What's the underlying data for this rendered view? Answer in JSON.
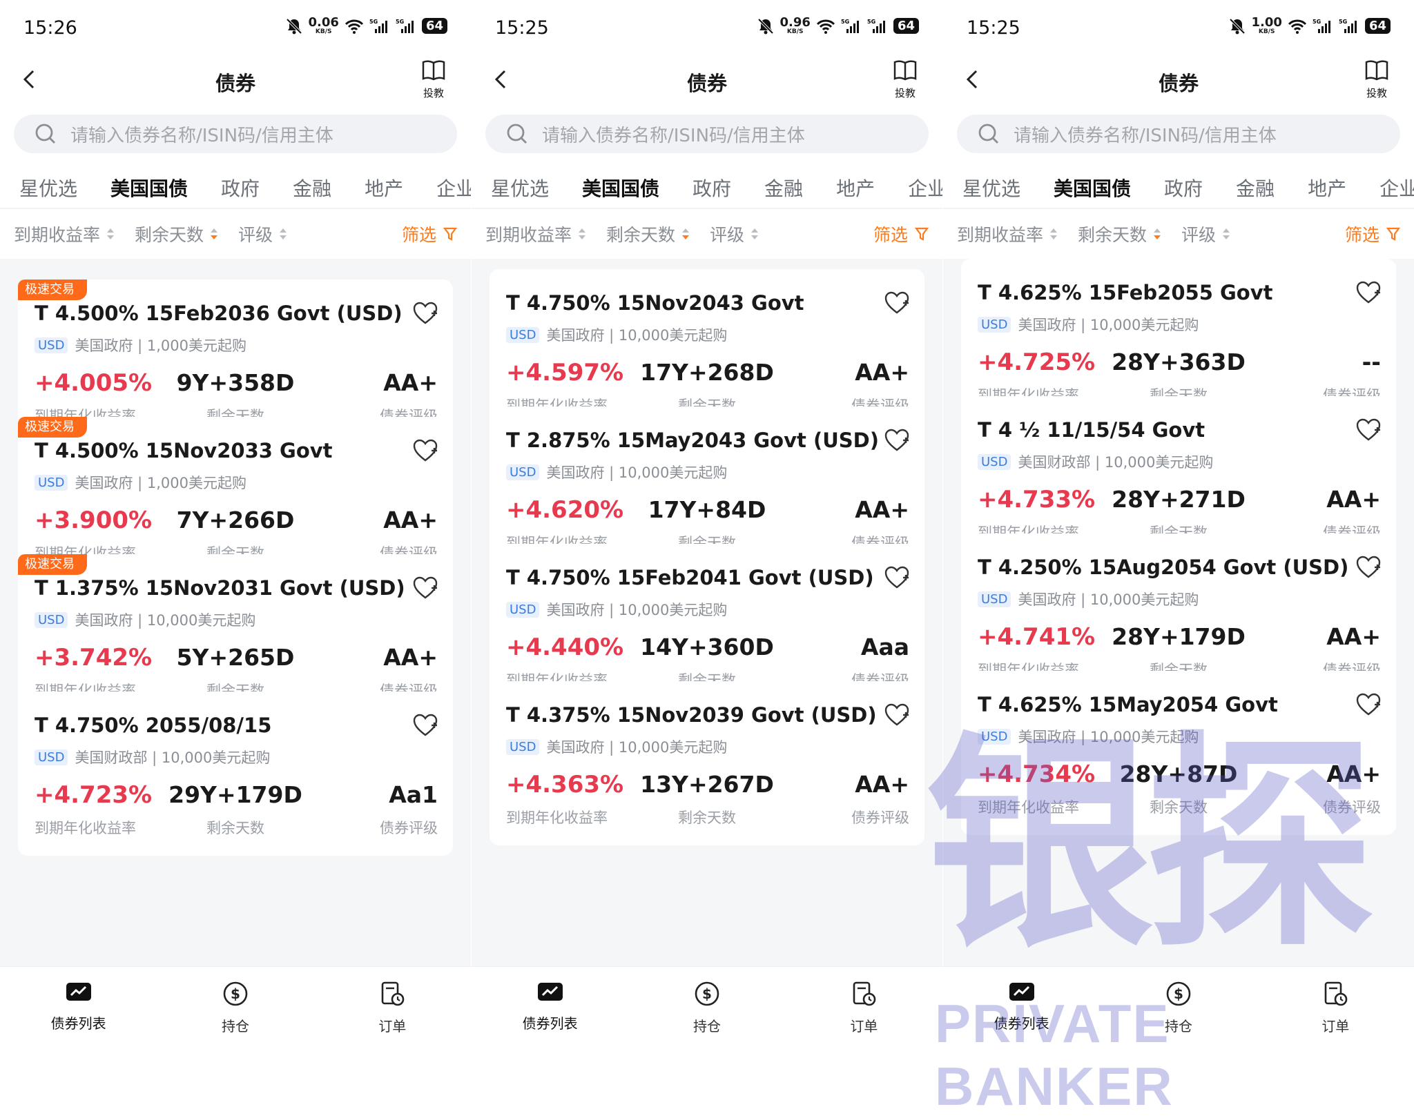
{
  "accent": "#ff7a1a",
  "yield_color": "#e83a4f",
  "screens": [
    {
      "status": {
        "time": "15:26",
        "speed": "0.06",
        "unit": "KB/S",
        "battery": "64"
      },
      "nav": {
        "title": "债券",
        "tutorial": "投教"
      },
      "search": {
        "placeholder": "请输入债券名称/ISIN码/信用主体"
      },
      "tabs": [
        "星优选",
        "美国国债",
        "政府",
        "金融",
        "地产",
        "企业"
      ],
      "sorts": [
        "到期收益率",
        "剩余天数",
        "评级"
      ],
      "filter": "筛选",
      "cards": [
        {
          "badge": "极速交易",
          "name": "T 4.500% 15Feb2036 Govt (USD)",
          "currency": "USD",
          "issuer": "美国政府 | 1,000美元起购",
          "yield": "+4.005%",
          "days": "9Y+358D",
          "rating": "AA+",
          "label_yield": "到期年化收益率",
          "label_days": "剩余天数",
          "label_rating": "债券评级"
        },
        {
          "badge": "极速交易",
          "name": "T 4.500% 15Nov2033 Govt",
          "currency": "USD",
          "issuer": "美国政府 | 1,000美元起购",
          "yield": "+3.900%",
          "days": "7Y+266D",
          "rating": "AA+",
          "label_yield": "到期年化收益率",
          "label_days": "剩余天数",
          "label_rating": "债券评级"
        },
        {
          "badge": "极速交易",
          "name": "T 1.375% 15Nov2031 Govt (USD)",
          "currency": "USD",
          "issuer": "美国政府 | 10,000美元起购",
          "yield": "+3.742%",
          "days": "5Y+265D",
          "rating": "AA+",
          "label_yield": "到期年化收益率",
          "label_days": "剩余天数",
          "label_rating": "债券评级"
        },
        {
          "badge": "",
          "name": "T 4.750% 2055/08/15",
          "currency": "USD",
          "issuer": "美国财政部 | 10,000美元起购",
          "yield": "+4.723%",
          "days": "29Y+179D",
          "rating": "Aa1",
          "label_yield": "到期年化收益率",
          "label_days": "剩余天数",
          "label_rating": "债券评级"
        }
      ],
      "bottom": [
        "债券列表",
        "持仓",
        "订单"
      ]
    },
    {
      "status": {
        "time": "15:25",
        "speed": "0.96",
        "unit": "KB/S",
        "battery": "64"
      },
      "nav": {
        "title": "债券",
        "tutorial": "投教"
      },
      "search": {
        "placeholder": "请输入债券名称/ISIN码/信用主体"
      },
      "tabs": [
        "星优选",
        "美国国债",
        "政府",
        "金融",
        "地产",
        "企业"
      ],
      "sorts": [
        "到期收益率",
        "剩余天数",
        "评级"
      ],
      "filter": "筛选",
      "cards": [
        {
          "badge": "",
          "name": "T 4.750% 15Nov2043 Govt",
          "currency": "USD",
          "issuer": "美国政府 | 10,000美元起购",
          "yield": "+4.597%",
          "days": "17Y+268D",
          "rating": "AA+",
          "label_yield": "到期年化收益率",
          "label_days": "剩余天数",
          "label_rating": "债券评级"
        },
        {
          "badge": "",
          "name": "T 2.875% 15May2043 Govt (USD)",
          "currency": "USD",
          "issuer": "美国政府 | 10,000美元起购",
          "yield": "+4.620%",
          "days": "17Y+84D",
          "rating": "AA+",
          "label_yield": "到期年化收益率",
          "label_days": "剩余天数",
          "label_rating": "债券评级"
        },
        {
          "badge": "",
          "name": "T 4.750% 15Feb2041 Govt (USD)",
          "currency": "USD",
          "issuer": "美国政府 | 10,000美元起购",
          "yield": "+4.440%",
          "days": "14Y+360D",
          "rating": "Aaa",
          "label_yield": "到期年化收益率",
          "label_days": "剩余天数",
          "label_rating": "债券评级"
        },
        {
          "badge": "",
          "name": "T 4.375% 15Nov2039 Govt (USD)",
          "currency": "USD",
          "issuer": "美国政府 | 10,000美元起购",
          "yield": "+4.363%",
          "days": "13Y+267D",
          "rating": "AA+",
          "label_yield": "到期年化收益率",
          "label_days": "剩余天数",
          "label_rating": "债券评级"
        }
      ],
      "bottom": [
        "债券列表",
        "持仓",
        "订单"
      ]
    },
    {
      "status": {
        "time": "15:25",
        "speed": "1.00",
        "unit": "KB/S",
        "battery": "64"
      },
      "nav": {
        "title": "债券",
        "tutorial": "投教"
      },
      "search": {
        "placeholder": "请输入债券名称/ISIN码/信用主体"
      },
      "tabs": [
        "星优选",
        "美国国债",
        "政府",
        "金融",
        "地产",
        "企业"
      ],
      "sorts": [
        "到期收益率",
        "剩余天数",
        "评级"
      ],
      "filter": "筛选",
      "cards": [
        {
          "badge": "",
          "name": "T 4.625% 15Feb2055 Govt",
          "currency": "USD",
          "issuer": "美国政府 | 10,000美元起购",
          "yield": "+4.725%",
          "days": "28Y+363D",
          "rating": "--",
          "label_yield": "到期年化收益率",
          "label_days": "剩余天数",
          "label_rating": "债券评级"
        },
        {
          "badge": "",
          "name": "T 4 ½ 11/15/54 Govt",
          "currency": "USD",
          "issuer": "美国财政部 | 10,000美元起购",
          "yield": "+4.733%",
          "days": "28Y+271D",
          "rating": "AA+",
          "label_yield": "到期年化收益率",
          "label_days": "剩余天数",
          "label_rating": "债券评级"
        },
        {
          "badge": "",
          "name": "T 4.250% 15Aug2054 Govt (USD)",
          "currency": "USD",
          "issuer": "美国政府 | 10,000美元起购",
          "yield": "+4.741%",
          "days": "28Y+179D",
          "rating": "AA+",
          "label_yield": "到期年化收益率",
          "label_days": "剩余天数",
          "label_rating": "债券评级"
        },
        {
          "badge": "",
          "name": "T 4.625% 15May2054 Govt",
          "currency": "USD",
          "issuer": "美国政府 | 10,000美元起购",
          "yield": "+4.734%",
          "days": "28Y+87D",
          "rating": "AA+",
          "label_yield": "到期年化收益率",
          "label_days": "剩余天数",
          "label_rating": "债券评级"
        }
      ],
      "bottom": [
        "债券列表",
        "持仓",
        "订单"
      ]
    }
  ],
  "watermark": {
    "cn": "银探",
    "en": "PRIVATE BANKER"
  }
}
